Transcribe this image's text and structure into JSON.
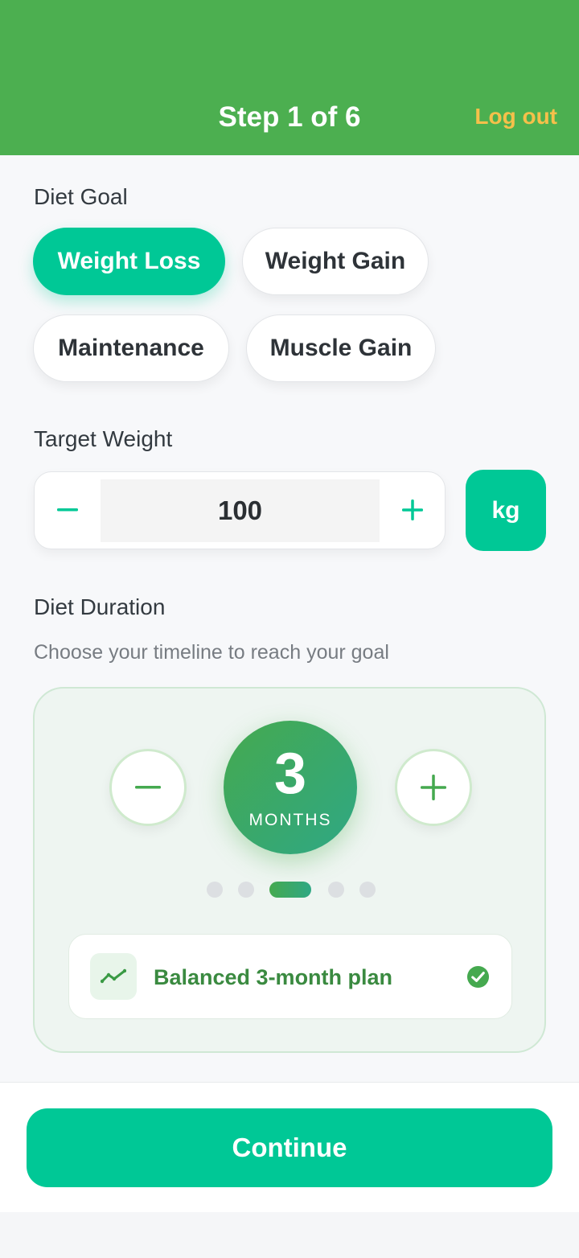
{
  "header": {
    "title": "Step 1 of 6",
    "logout_label": "Log out"
  },
  "diet_goal": {
    "title": "Diet Goal",
    "options": [
      "Weight Loss",
      "Weight Gain",
      "Maintenance",
      "Muscle Gain"
    ],
    "selected": "Weight Loss"
  },
  "target_weight": {
    "title": "Target Weight",
    "value": "100",
    "unit": "kg"
  },
  "diet_duration": {
    "title": "Diet Duration",
    "subtitle": "Choose your timeline to reach your goal",
    "value": "3",
    "unit_label": "MONTHS",
    "dot_count": 5,
    "active_dot_index": 2,
    "plan_label": "Balanced 3-month plan"
  },
  "footer": {
    "continue_label": "Continue"
  },
  "colors": {
    "header": "#4caf50",
    "accent": "#00c896",
    "logout": "#f5c04a",
    "plan_text": "#3a8a40"
  },
  "icons": [
    "minus-icon",
    "plus-icon",
    "trend-icon",
    "check-circle-icon"
  ]
}
